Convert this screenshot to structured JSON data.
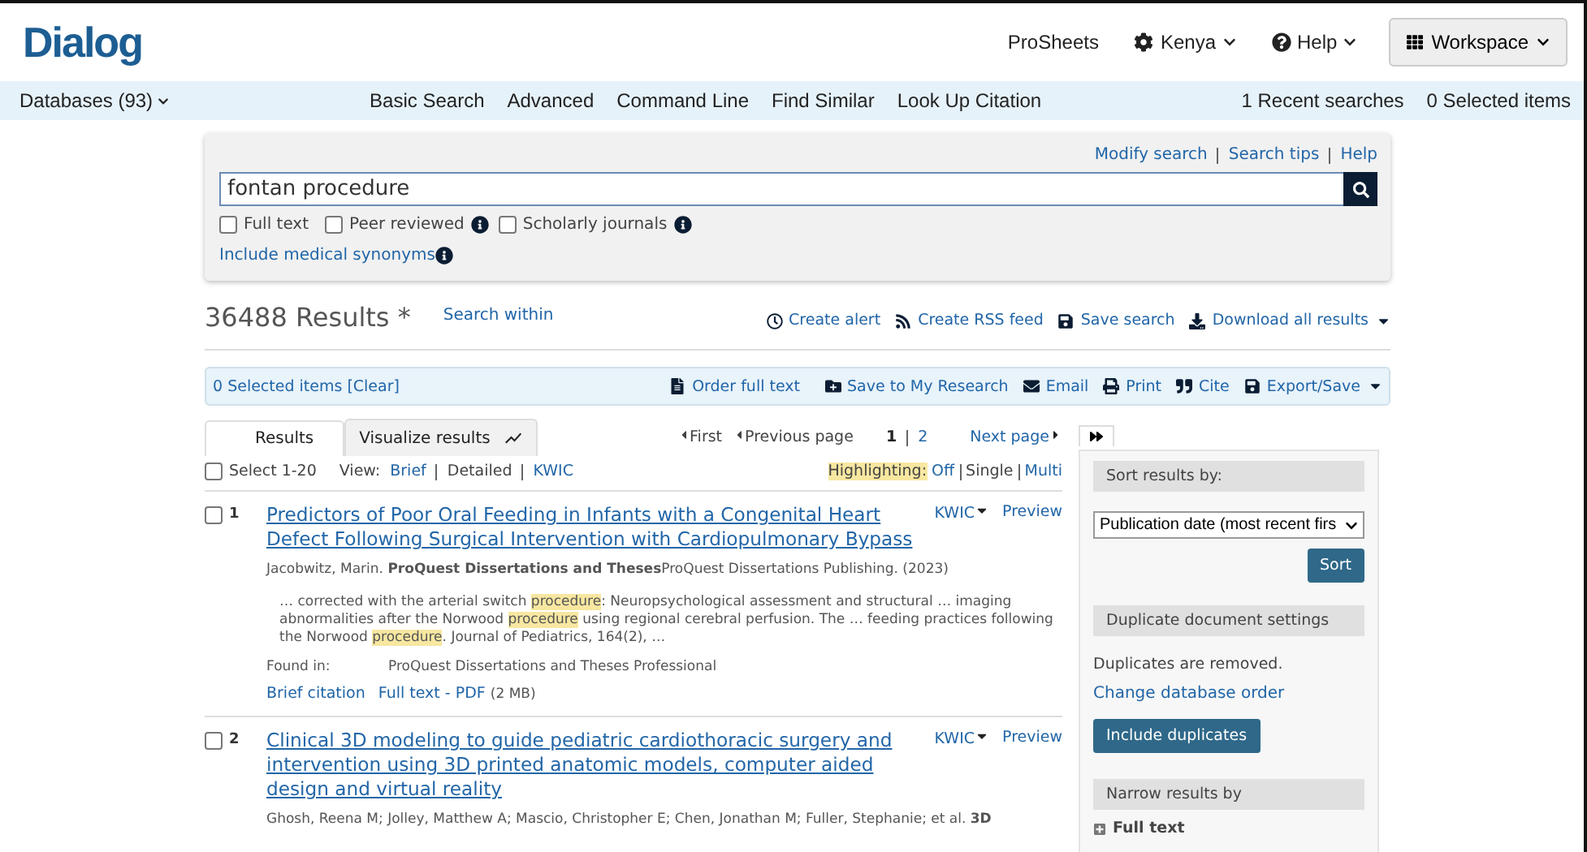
{
  "header": {
    "logo": "Dialog",
    "links": [
      "ProSheets",
      "Kenya",
      "Help"
    ],
    "workspace": "Workspace"
  },
  "nav": {
    "databases": "Databases (93)",
    "items": [
      "Basic Search",
      "Advanced",
      "Command Line",
      "Find Similar",
      "Look Up Citation"
    ],
    "right": [
      "1 Recent searches",
      "0 Selected items"
    ]
  },
  "search": {
    "links": [
      "Modify search",
      "Search tips",
      "Help"
    ],
    "value": "fontan procedure",
    "filters": [
      {
        "label": "Full text",
        "checked": false,
        "info": false
      },
      {
        "label": "Peer reviewed",
        "checked": false,
        "info": true
      },
      {
        "label": "Scholarly journals",
        "checked": false,
        "info": true
      }
    ],
    "synonyms": "Include medical synonyms"
  },
  "results": {
    "count": "36488 Results *",
    "search_within": "Search within",
    "actions": [
      "Create alert",
      "Create RSS feed",
      "Save search",
      "Download all results"
    ],
    "selected": "0 Selected items [Clear]",
    "toolbar": [
      "Order full text",
      "Save to My Research",
      "Email",
      "Print",
      "Cite",
      "Export/Save"
    ],
    "tabs": [
      {
        "label": "Results",
        "selected": true
      },
      {
        "label": "Visualize results",
        "selected": false
      }
    ],
    "pagination": {
      "first": "First",
      "previous": "Previous page",
      "pages": [
        {
          "label": "1",
          "selected": true
        },
        {
          "label": "2",
          "selected": false
        }
      ],
      "next": "Next page"
    },
    "select_all": {
      "label": "Select 1-20",
      "checked": false
    },
    "view_label": "View:",
    "views": [
      {
        "label": "Brief",
        "selected": false
      },
      {
        "label": "Detailed",
        "selected": true
      },
      {
        "label": "KWIC",
        "selected": false
      }
    ],
    "highlighting": {
      "label": "Highlighting:",
      "options": [
        {
          "label": "Off",
          "selected": false
        },
        {
          "label": "Single",
          "selected": true
        },
        {
          "label": "Multi",
          "selected": false
        }
      ]
    },
    "items": [
      {
        "number": "1",
        "checked": false,
        "title": "Predictors of Poor Oral Feeding in Infants with a Congenital Heart Defect Following Surgical Intervention with Cardiopulmonary Bypass",
        "kwic": "KWIC",
        "preview": "Preview",
        "citation": "Jacobwitz, Marin. **ProQuest Dissertations and Theses**ProQuest Dissertations Publishing. (2023)",
        "snippet": [
          {
            "text": "… corrected with the arterial switch ",
            "highlighted": false
          },
          {
            "text": "procedure",
            "highlighted": true
          },
          {
            "text": ": Neuropsychological assessment and structural … imaging abnormalities after the Norwood ",
            "highlighted": false
          },
          {
            "text": "procedure",
            "highlighted": true
          },
          {
            "text": " using regional cerebral perfusion. The … feeding practices following the Norwood ",
            "highlighted": false
          },
          {
            "text": "procedure",
            "highlighted": true
          },
          {
            "text": ". Journal of Pediatrics, 164(2), …",
            "highlighted": false
          }
        ],
        "found_label": "Found in:",
        "found_value": "ProQuest Dissertations and Theses Professional",
        "links": [
          "Brief citation",
          "Full text - PDF"
        ],
        "size": "(2 MB)"
      },
      {
        "number": "2",
        "checked": false,
        "title": "Clinical 3D modeling to guide pediatric cardiothoracic surgery and intervention using 3D printed anatomic models, computer aided design and virtual reality",
        "kwic": "KWIC",
        "preview": "Preview",
        "citation": "Ghosh, Reena M; Jolley, Matthew A; Mascio, Christopher E; Chen, Jonathan M; Fuller, Stephanie; et al. **3D**"
      }
    ]
  },
  "sidebar": {
    "sort_heading": "Sort results by:",
    "sort_value": "Publication date (most recent firs",
    "sort_button": "Sort",
    "dup_heading": "Duplicate document settings",
    "dup_text": "Duplicates are removed.",
    "dup_link": "Change database order",
    "dup_button": "Include duplicates",
    "narrow_heading": "Narrow results by",
    "narrow_first": "Full text"
  }
}
